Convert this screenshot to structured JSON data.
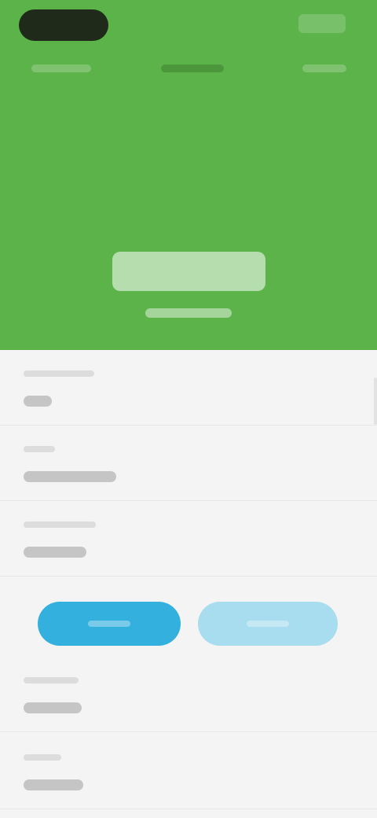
{
  "header": {
    "background_color": "#5bb349",
    "logo_icon": "app-logo-icon",
    "tabs": [
      {
        "label": ""
      },
      {
        "label": ""
      },
      {
        "label": ""
      }
    ],
    "amount": ""
  },
  "form": {
    "fields": [
      {
        "label": "",
        "value": ""
      },
      {
        "label": "",
        "value": ""
      },
      {
        "label": "",
        "value": ""
      },
      {
        "label": "",
        "value": ""
      },
      {
        "label": "",
        "value": ""
      }
    ],
    "primary_button_label": "",
    "secondary_button_label": "",
    "primary_color": "#33b0de",
    "secondary_color": "#a8dcef"
  }
}
